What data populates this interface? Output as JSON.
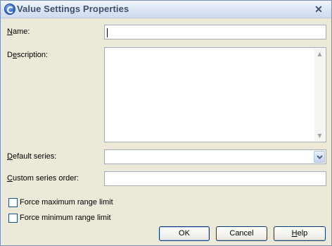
{
  "window": {
    "title": "Value Settings Properties",
    "close_symbol": "✕",
    "icon": "app-icon"
  },
  "form": {
    "name": {
      "label_access": "N",
      "label_rest": "ame:",
      "value": ""
    },
    "description": {
      "label_pre": "D",
      "label_access": "e",
      "label_rest": "scription:",
      "value": ""
    },
    "default_series": {
      "label_access": "D",
      "label_rest": "efault series:",
      "selected": ""
    },
    "custom_series_order": {
      "label_access": "C",
      "label_rest": "ustom series order:",
      "value": ""
    },
    "force_max": {
      "label": "Force maximum range limit",
      "checked": false
    },
    "force_min": {
      "label": "Force minimum range limit",
      "checked": false
    }
  },
  "buttons": {
    "ok": "OK",
    "cancel": "Cancel",
    "help_access": "H",
    "help_rest": "elp"
  },
  "icons": {
    "scroll_up": "▲",
    "scroll_down": "▼",
    "dropdown": "chevron-down-icon"
  }
}
